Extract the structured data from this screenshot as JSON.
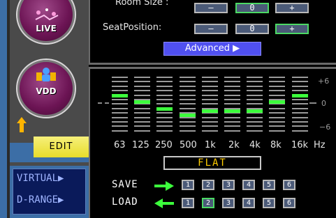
{
  "mode_buttons": {
    "live_label": "LIVE",
    "vdd_label": "VDD"
  },
  "edit_label": "EDIT",
  "side_links": {
    "virtual": "VIRTUAL▶",
    "drange": "D-RANGE▶"
  },
  "room_size": {
    "label": "Room Size :",
    "minus": "—",
    "zero": "0",
    "plus": "+",
    "selected": "zero"
  },
  "seat_position": {
    "label": "SeatPosition:",
    "minus": "—",
    "zero": "0",
    "plus": "+",
    "selected": "plus"
  },
  "advanced_label": "Advanced ▶",
  "equalizer": {
    "scale_labels": [
      "+6",
      "0",
      "−6"
    ],
    "bands": [
      {
        "freq": "63",
        "level": 2
      },
      {
        "freq": "125",
        "level": 0.5
      },
      {
        "freq": "250",
        "level": -1
      },
      {
        "freq": "500",
        "level": -2.5
      },
      {
        "freq": "1k",
        "level": -1.5
      },
      {
        "freq": "2k",
        "level": -1.5
      },
      {
        "freq": "4k",
        "level": -1.5
      },
      {
        "freq": "8k",
        "level": 0.5
      },
      {
        "freq": "16k",
        "level": 2
      }
    ],
    "unit": "Hz"
  },
  "preset_name": "FLAT",
  "save_label": "SAVE",
  "load_label": "LOAD",
  "slots": [
    "1",
    "2",
    "3",
    "4",
    "5",
    "6"
  ],
  "selected_load_slot": "2",
  "colors": {
    "accent_green": "#3cff3c",
    "highlight_yellow": "#e8dc2a",
    "advanced_blue": "#5050f0",
    "side_blue": "#3c6ea6"
  }
}
